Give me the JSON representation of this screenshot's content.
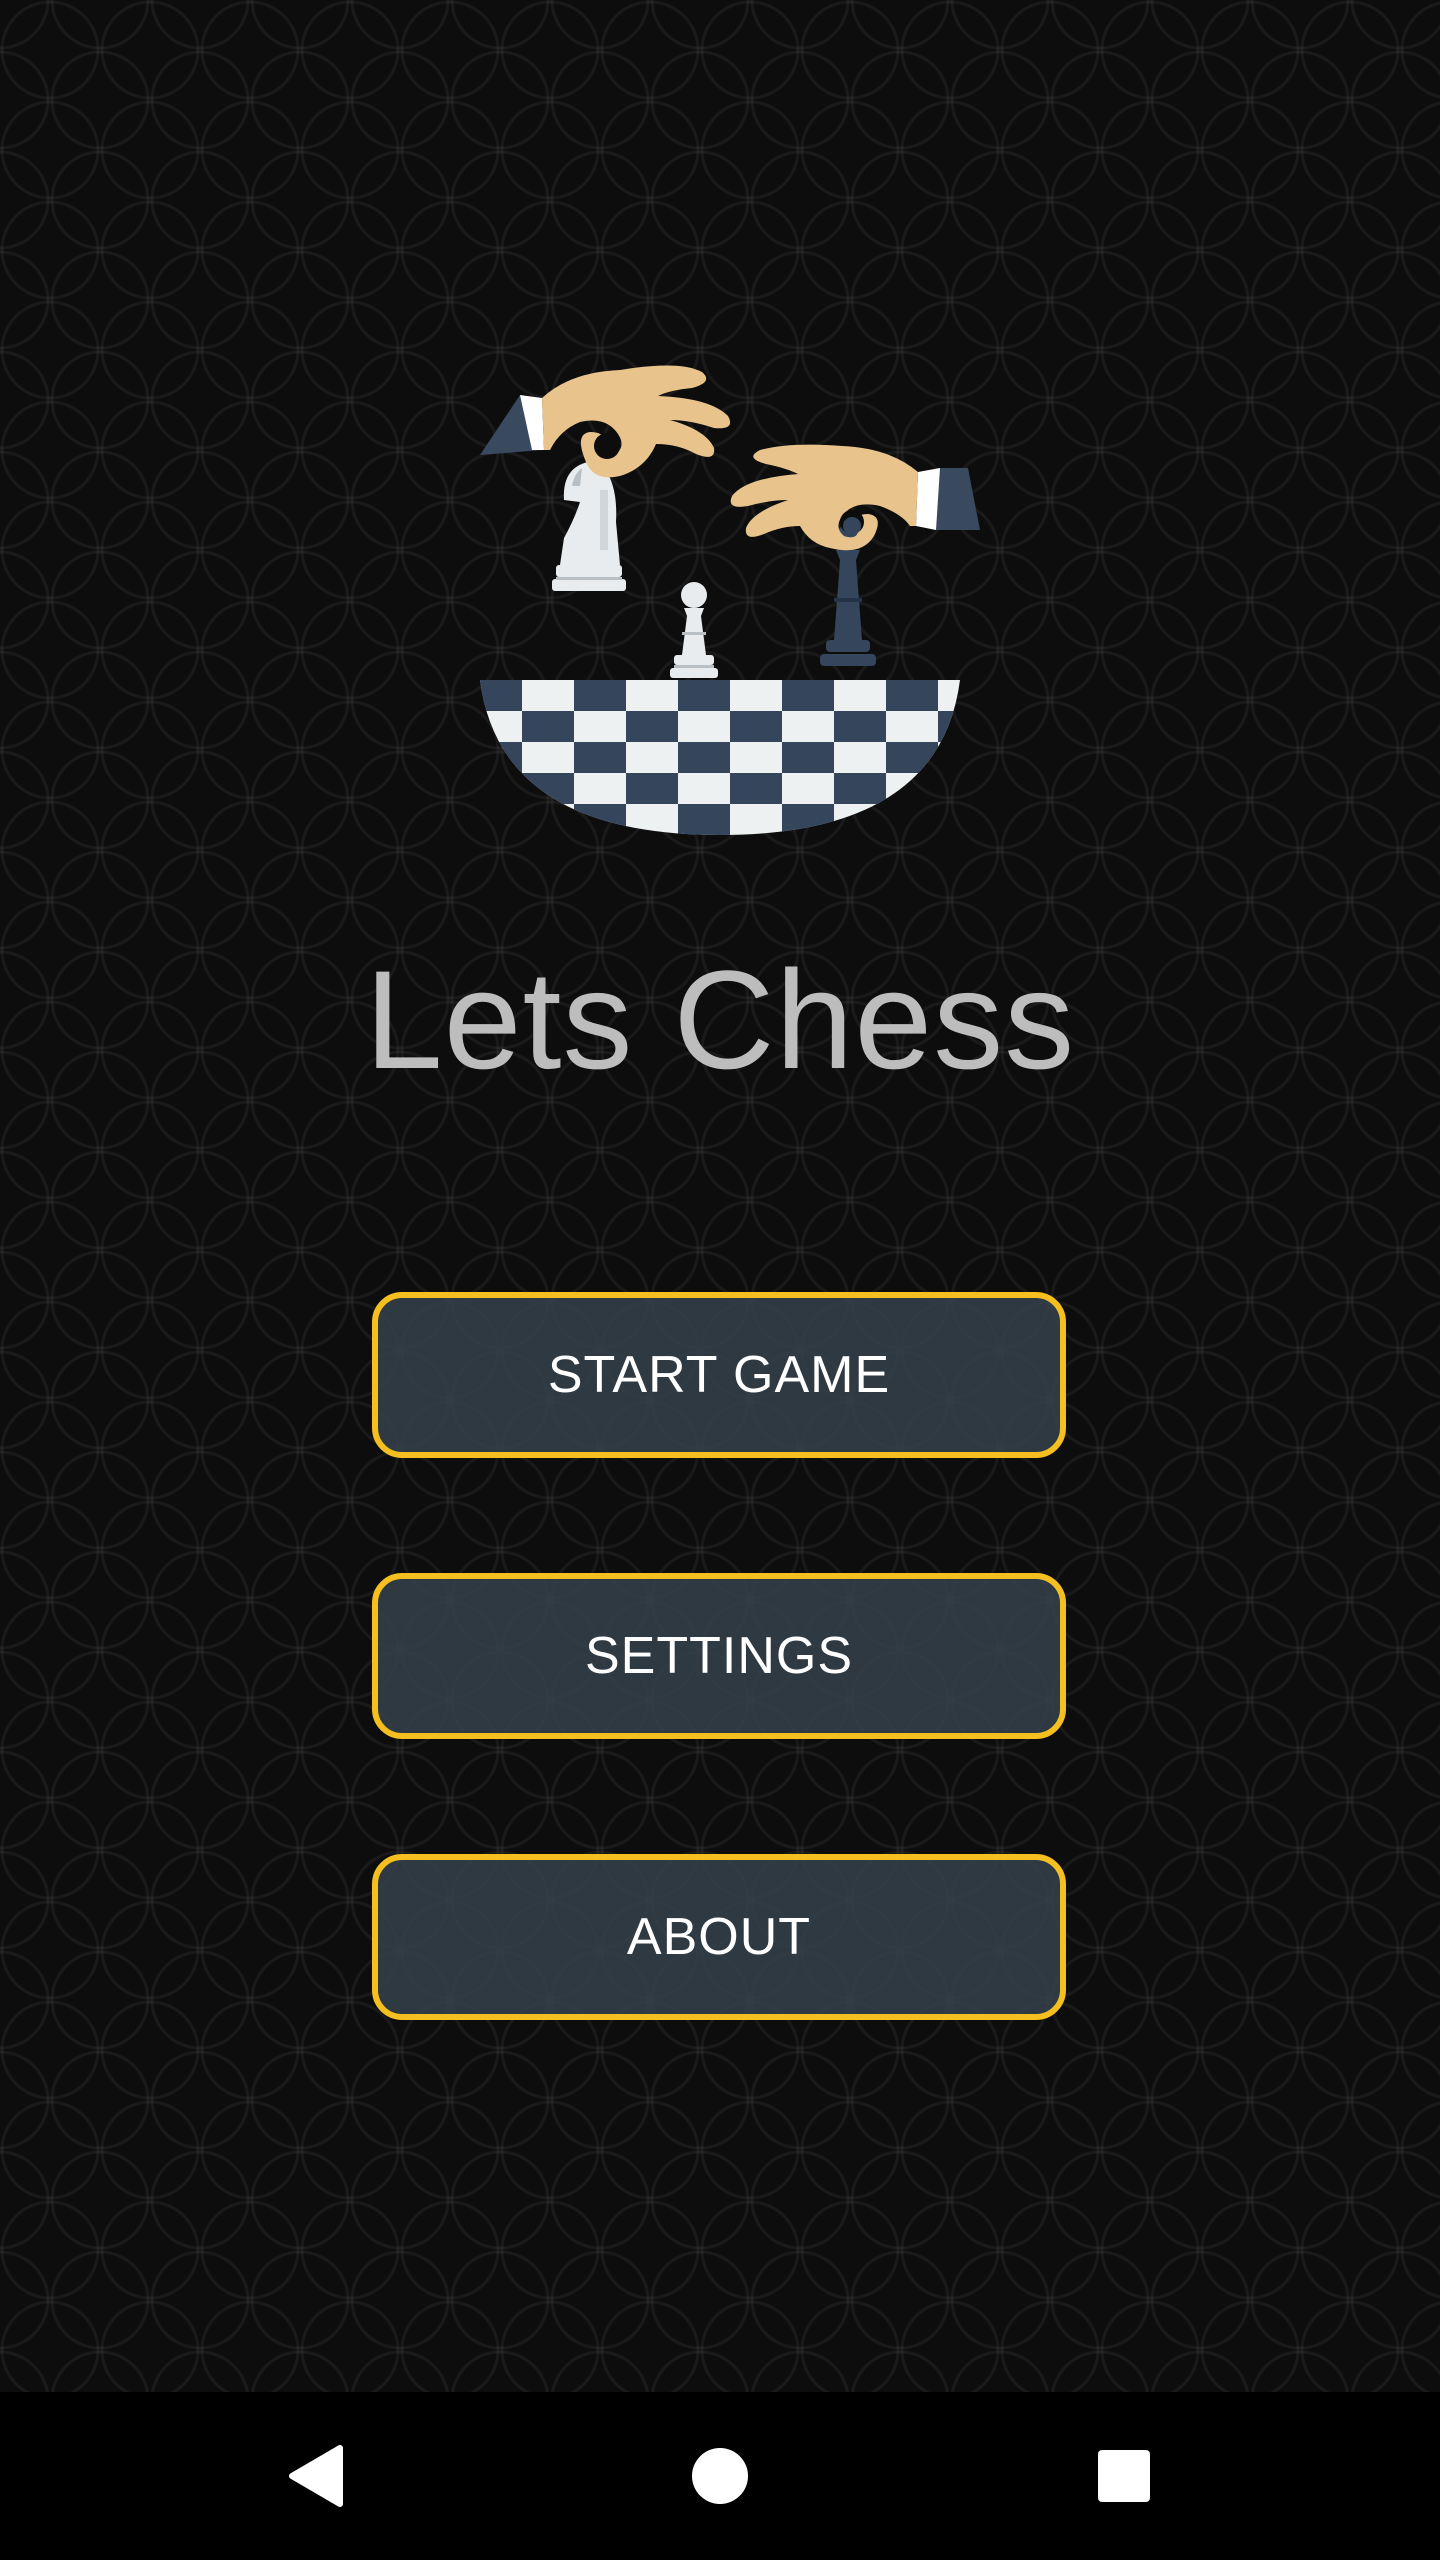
{
  "app": {
    "title": "Lets Chess"
  },
  "logo": {
    "icon": "chess-hands-logo",
    "colors": {
      "skin": "#e8c48c",
      "sleeve": "#3a4a5e",
      "cuff": "#ffffff",
      "white_piece": "#e8ecee",
      "dark_piece": "#34455c",
      "board_light": "#eef1f2",
      "board_dark": "#34455c"
    }
  },
  "menu": {
    "start_label": "START GAME",
    "settings_label": "SETTINGS",
    "about_label": "ABOUT",
    "border_color": "#f4bf1f",
    "fill_color": "#34404a"
  },
  "navigation": {
    "back_icon": "back-triangle-icon",
    "home_icon": "home-circle-icon",
    "recents_icon": "recents-square-icon"
  }
}
